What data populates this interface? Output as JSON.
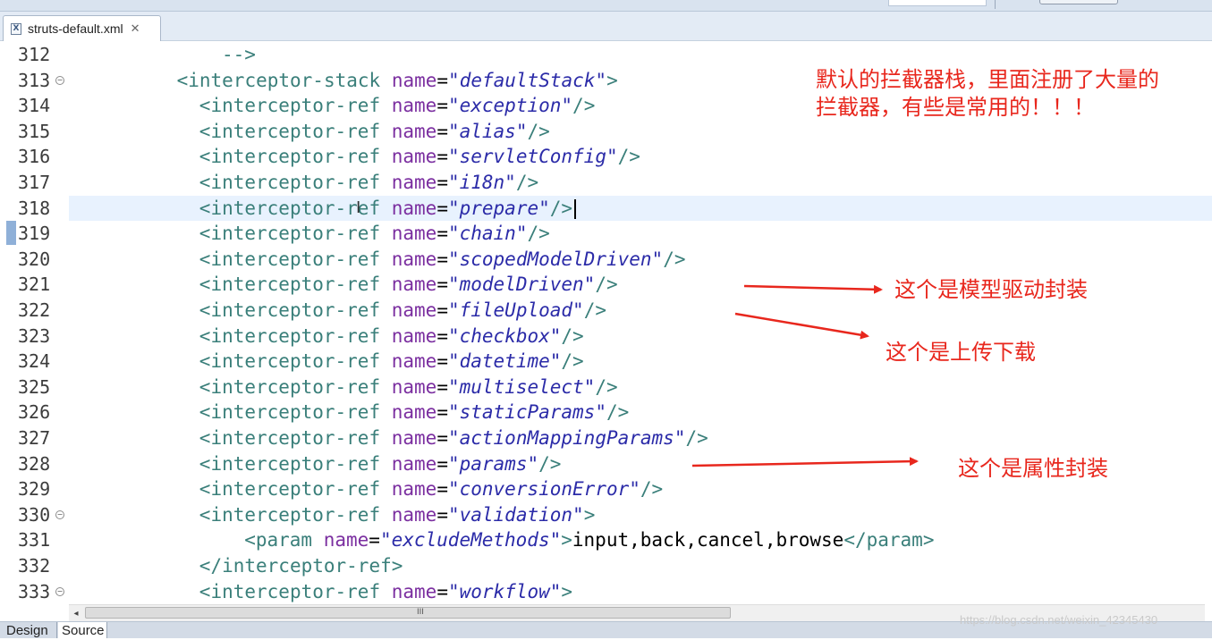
{
  "tab": {
    "title": "struts-default.xml",
    "icon": "xml-file-icon",
    "close_glyph": "✕"
  },
  "lines": [
    {
      "num": "312",
      "indent": 10,
      "fold": false,
      "parts": [
        [
          "tg",
          "-->"
        ]
      ]
    },
    {
      "num": "313",
      "indent": 6,
      "fold": true,
      "parts": [
        [
          "tg",
          "<interceptor-stack "
        ],
        [
          "at",
          "name"
        ],
        [
          "op",
          "="
        ],
        [
          "vl",
          "\"defaultStack\""
        ],
        [
          "tg",
          ">"
        ]
      ]
    },
    {
      "num": "314",
      "indent": 8,
      "fold": false,
      "parts": [
        [
          "tg",
          "<interceptor-ref "
        ],
        [
          "at",
          "name"
        ],
        [
          "op",
          "="
        ],
        [
          "vl",
          "\"exception\""
        ],
        [
          "tg",
          "/>"
        ]
      ]
    },
    {
      "num": "315",
      "indent": 8,
      "fold": false,
      "parts": [
        [
          "tg",
          "<interceptor-ref "
        ],
        [
          "at",
          "name"
        ],
        [
          "op",
          "="
        ],
        [
          "vl",
          "\"alias\""
        ],
        [
          "tg",
          "/>"
        ]
      ]
    },
    {
      "num": "316",
      "indent": 8,
      "fold": false,
      "parts": [
        [
          "tg",
          "<interceptor-ref "
        ],
        [
          "at",
          "name"
        ],
        [
          "op",
          "="
        ],
        [
          "vl",
          "\"servletConfig\""
        ],
        [
          "tg",
          "/>"
        ]
      ]
    },
    {
      "num": "317",
      "indent": 8,
      "fold": false,
      "parts": [
        [
          "tg",
          "<interceptor-ref "
        ],
        [
          "at",
          "name"
        ],
        [
          "op",
          "="
        ],
        [
          "vl",
          "\"i18n\""
        ],
        [
          "tg",
          "/>"
        ]
      ]
    },
    {
      "num": "318",
      "indent": 8,
      "fold": false,
      "current": true,
      "parts": [
        [
          "tg",
          "<interceptor-ref "
        ],
        [
          "at",
          "name"
        ],
        [
          "op",
          "="
        ],
        [
          "vl",
          "\"prepare\""
        ],
        [
          "tg",
          "/>"
        ]
      ]
    },
    {
      "num": "319",
      "indent": 8,
      "fold": false,
      "parts": [
        [
          "tg",
          "<interceptor-ref "
        ],
        [
          "at",
          "name"
        ],
        [
          "op",
          "="
        ],
        [
          "vl",
          "\"chain\""
        ],
        [
          "tg",
          "/>"
        ]
      ]
    },
    {
      "num": "320",
      "indent": 8,
      "fold": false,
      "parts": [
        [
          "tg",
          "<interceptor-ref "
        ],
        [
          "at",
          "name"
        ],
        [
          "op",
          "="
        ],
        [
          "vl",
          "\"scopedModelDriven\""
        ],
        [
          "tg",
          "/>"
        ]
      ]
    },
    {
      "num": "321",
      "indent": 8,
      "fold": false,
      "parts": [
        [
          "tg",
          "<interceptor-ref "
        ],
        [
          "at",
          "name"
        ],
        [
          "op",
          "="
        ],
        [
          "vl",
          "\"modelDriven\""
        ],
        [
          "tg",
          "/>"
        ]
      ]
    },
    {
      "num": "322",
      "indent": 8,
      "fold": false,
      "parts": [
        [
          "tg",
          "<interceptor-ref "
        ],
        [
          "at",
          "name"
        ],
        [
          "op",
          "="
        ],
        [
          "vl",
          "\"fileUpload\""
        ],
        [
          "tg",
          "/>"
        ]
      ]
    },
    {
      "num": "323",
      "indent": 8,
      "fold": false,
      "parts": [
        [
          "tg",
          "<interceptor-ref "
        ],
        [
          "at",
          "name"
        ],
        [
          "op",
          "="
        ],
        [
          "vl",
          "\"checkbox\""
        ],
        [
          "tg",
          "/>"
        ]
      ]
    },
    {
      "num": "324",
      "indent": 8,
      "fold": false,
      "parts": [
        [
          "tg",
          "<interceptor-ref "
        ],
        [
          "at",
          "name"
        ],
        [
          "op",
          "="
        ],
        [
          "vl",
          "\"datetime\""
        ],
        [
          "tg",
          "/>"
        ]
      ]
    },
    {
      "num": "325",
      "indent": 8,
      "fold": false,
      "parts": [
        [
          "tg",
          "<interceptor-ref "
        ],
        [
          "at",
          "name"
        ],
        [
          "op",
          "="
        ],
        [
          "vl",
          "\"multiselect\""
        ],
        [
          "tg",
          "/>"
        ]
      ]
    },
    {
      "num": "326",
      "indent": 8,
      "fold": false,
      "parts": [
        [
          "tg",
          "<interceptor-ref "
        ],
        [
          "at",
          "name"
        ],
        [
          "op",
          "="
        ],
        [
          "vl",
          "\"staticParams\""
        ],
        [
          "tg",
          "/>"
        ]
      ]
    },
    {
      "num": "327",
      "indent": 8,
      "fold": false,
      "parts": [
        [
          "tg",
          "<interceptor-ref "
        ],
        [
          "at",
          "name"
        ],
        [
          "op",
          "="
        ],
        [
          "vl",
          "\"actionMappingParams\""
        ],
        [
          "tg",
          "/>"
        ]
      ]
    },
    {
      "num": "328",
      "indent": 8,
      "fold": false,
      "parts": [
        [
          "tg",
          "<interceptor-ref "
        ],
        [
          "at",
          "name"
        ],
        [
          "op",
          "="
        ],
        [
          "vl",
          "\"params\""
        ],
        [
          "tg",
          "/>"
        ]
      ]
    },
    {
      "num": "329",
      "indent": 8,
      "fold": false,
      "parts": [
        [
          "tg",
          "<interceptor-ref "
        ],
        [
          "at",
          "name"
        ],
        [
          "op",
          "="
        ],
        [
          "vl",
          "\"conversionError\""
        ],
        [
          "tg",
          "/>"
        ]
      ]
    },
    {
      "num": "330",
      "indent": 8,
      "fold": true,
      "parts": [
        [
          "tg",
          "<interceptor-ref "
        ],
        [
          "at",
          "name"
        ],
        [
          "op",
          "="
        ],
        [
          "vl",
          "\"validation\""
        ],
        [
          "tg",
          ">"
        ]
      ]
    },
    {
      "num": "331",
      "indent": 12,
      "fold": false,
      "parts": [
        [
          "tg",
          "<param "
        ],
        [
          "at",
          "name"
        ],
        [
          "op",
          "="
        ],
        [
          "vl",
          "\"excludeMethods\""
        ],
        [
          "tg",
          ">"
        ],
        [
          "tx",
          "input,back,cancel,browse"
        ],
        [
          "tg",
          "</param>"
        ]
      ]
    },
    {
      "num": "332",
      "indent": 8,
      "fold": false,
      "parts": [
        [
          "tg",
          "</interceptor-ref>"
        ]
      ]
    },
    {
      "num": "333",
      "indent": 8,
      "fold": true,
      "parts": [
        [
          "tg",
          "<interceptor-ref "
        ],
        [
          "at",
          "name"
        ],
        [
          "op",
          "="
        ],
        [
          "vl",
          "\"workflow\""
        ],
        [
          "tg",
          ">"
        ]
      ]
    }
  ],
  "annotations": {
    "top_line1": "默认的拦截器栈，里面注册了大量的",
    "top_line2": "拦截器，有些是常用的！！！",
    "model_driven": "这个是模型驱动封装",
    "file_upload": "这个是上传下载",
    "params": "这个是属性封装"
  },
  "colors": {
    "annotation": "#e8271d",
    "tag": "#3a7f7a",
    "attribute": "#7b2fa0",
    "value": "#2b2ba8",
    "current_line": "#e8f2fe"
  },
  "scrollbar": {
    "grip": "III"
  },
  "bottom_tabs": [
    {
      "label": "Design",
      "active": false
    },
    {
      "label": "Source",
      "active": true
    }
  ],
  "watermark": "https://blog.csdn.net/weixin_42345430"
}
